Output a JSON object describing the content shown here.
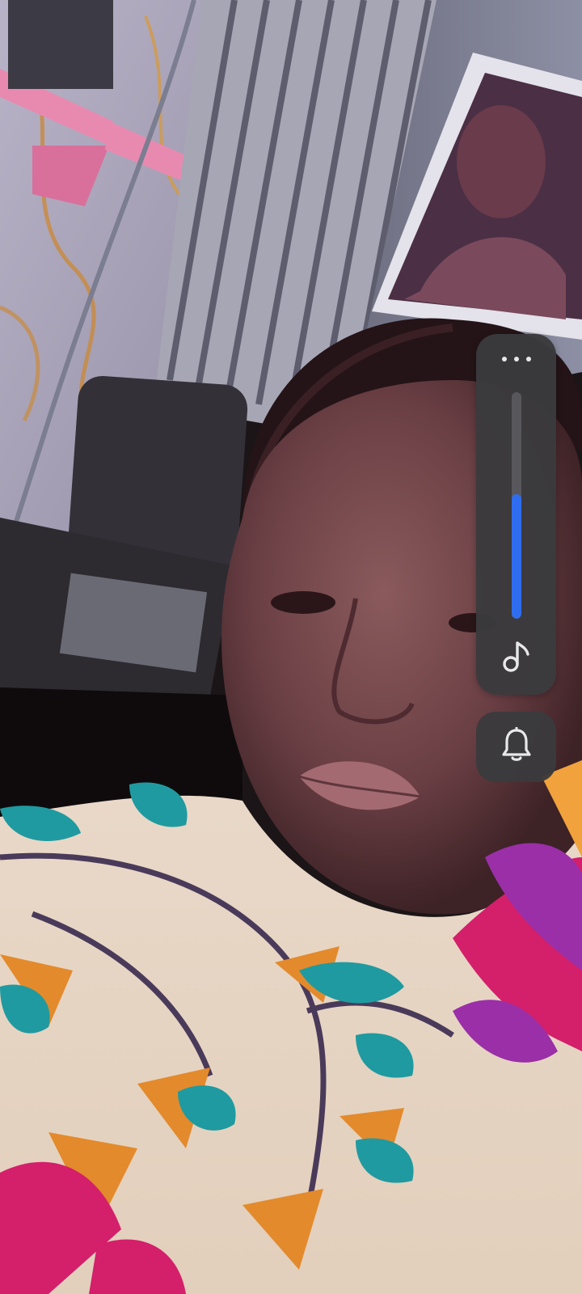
{
  "background": {
    "description_icon": "camera-photo"
  },
  "volume_panel": {
    "more_icon": "more-horizontal-icon",
    "media_icon": "music-note-icon",
    "level": 0.55,
    "track_color": "#58585c",
    "fill_color": "#2f6df0",
    "panel_color": "#3a3a3c"
  },
  "ringer": {
    "icon": "bell-icon"
  }
}
